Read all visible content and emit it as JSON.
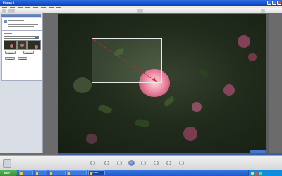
{
  "window": {
    "title": "Picasa 3"
  },
  "menubar": {
    "items": [
      "",
      "",
      "",
      "",
      "",
      "",
      "",
      ""
    ]
  },
  "toolbar": {
    "buttons": [
      "back",
      "library",
      "grid",
      "rotate"
    ]
  },
  "left_panel": {
    "tab_label": "",
    "heading": "",
    "description": "",
    "aspect_label": "",
    "buttons": {
      "preview": "",
      "reset": "",
      "apply": "",
      "cancel": ""
    }
  },
  "crop_tool": {
    "active": true
  },
  "taskbar": {
    "start_label": "start",
    "tasks": [
      {
        "label": ""
      },
      {
        "label": ""
      },
      {
        "label": ""
      },
      {
        "label": ""
      },
      {
        "label": "Picasa 3"
      }
    ],
    "clock": ""
  },
  "colors": {
    "accent": "#2f6fe0",
    "taskbar": "#1f57c7",
    "crop_guide": "#e02020",
    "rose": "#e07a96"
  }
}
